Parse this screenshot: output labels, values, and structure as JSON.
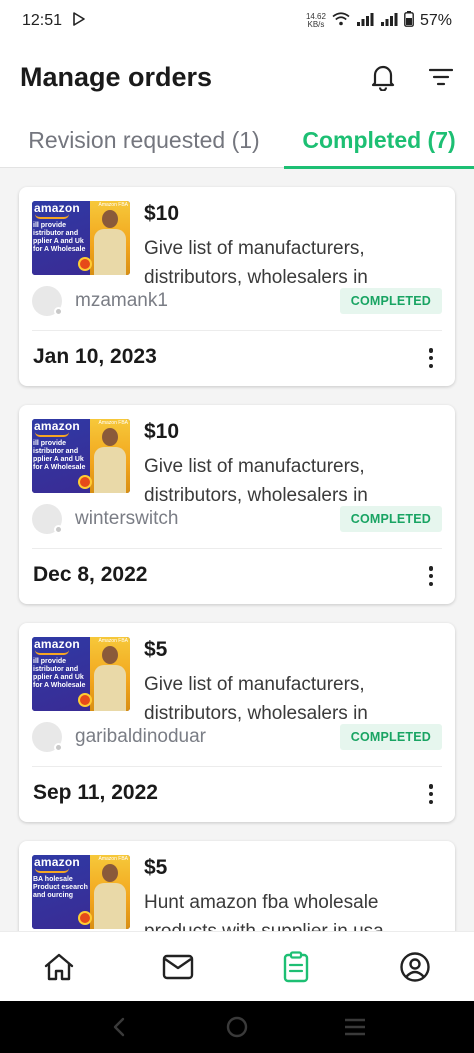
{
  "status_bar": {
    "time": "12:51",
    "net_speed_value": "14.62",
    "net_speed_unit": "KB/s",
    "battery": "57%"
  },
  "header": {
    "title": "Manage orders"
  },
  "tabs": [
    {
      "label": "Revision requested (1)",
      "active": false
    },
    {
      "label": "Completed (7)",
      "active": true
    }
  ],
  "thumbnail": {
    "logo_text": "amazon",
    "corner_tag": "Amazon FBA",
    "caption_a": "ill provide istributor and pplier A and Uk for A Wholesale",
    "caption_b": "BA holesale Product esearch and ourcing"
  },
  "orders": [
    {
      "price": "$10",
      "description": "Give list of manufacturers, distributors, wholesalers  in",
      "buyer": "mzamank1",
      "status": "COMPLETED",
      "date": "Jan 10, 2023"
    },
    {
      "price": "$10",
      "description": "Give list of manufacturers, distributors, wholesalers  in",
      "buyer": "winterswitch",
      "status": "COMPLETED",
      "date": "Dec 8, 2022"
    },
    {
      "price": "$5",
      "description": "Give list of manufacturers, distributors, wholesalers  in",
      "buyer": "garibaldinoduar",
      "status": "COMPLETED",
      "date": "Sep 11, 2022"
    },
    {
      "price": "$5",
      "description": "Hunt amazon fba wholesale products with supplier in usa",
      "buyer": "",
      "status": "",
      "date": ""
    }
  ],
  "bottom_nav": {
    "items": [
      "home-icon",
      "inbox-icon",
      "orders-icon",
      "profile-icon"
    ],
    "active": "orders-icon",
    "active_color": "#1dbf73",
    "inactive_color": "#222222"
  },
  "colors": {
    "accent": "#1dbf73",
    "badge_bg": "#e6f6ee",
    "badge_text": "#19a463"
  }
}
